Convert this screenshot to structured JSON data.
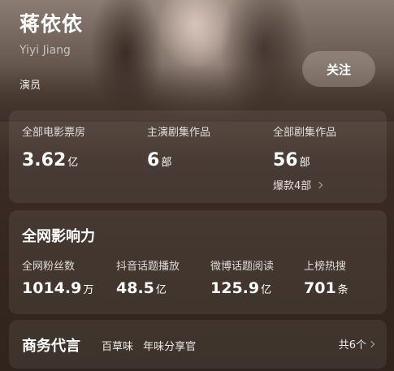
{
  "profile": {
    "name": "蒋依依",
    "name_en": "Yiyi Jiang",
    "role": "演员",
    "follow_label": "关注"
  },
  "box_office": {
    "stats": [
      {
        "label": "全部电影票房",
        "value": "3.62",
        "unit": "亿"
      },
      {
        "label": "主演剧集作品",
        "value": "6",
        "unit": "部"
      },
      {
        "label": "全部剧集作品",
        "value": "56",
        "unit": "部"
      }
    ],
    "hot_label": "爆款4部",
    "hot_icon": "chevron-right-icon"
  },
  "influence": {
    "title": "全网影响力",
    "stats": [
      {
        "label": "全网粉丝数",
        "value": "1014.9",
        "unit": "万"
      },
      {
        "label": "抖音话题播放",
        "value": "48.5",
        "unit": "亿"
      },
      {
        "label": "微博话题阅读",
        "value": "125.9",
        "unit": "亿"
      },
      {
        "label": "上榜热搜",
        "value": "701",
        "unit": "条"
      }
    ]
  },
  "endorsement": {
    "title": "商务代言",
    "brands": [
      "百草味",
      "年味分享官"
    ],
    "count_label": "共6个",
    "count_icon": "chevron-right-icon"
  },
  "colors": {
    "background_top": "#8a7c72",
    "background_bottom": "#30241d",
    "text": "#ffffff"
  }
}
